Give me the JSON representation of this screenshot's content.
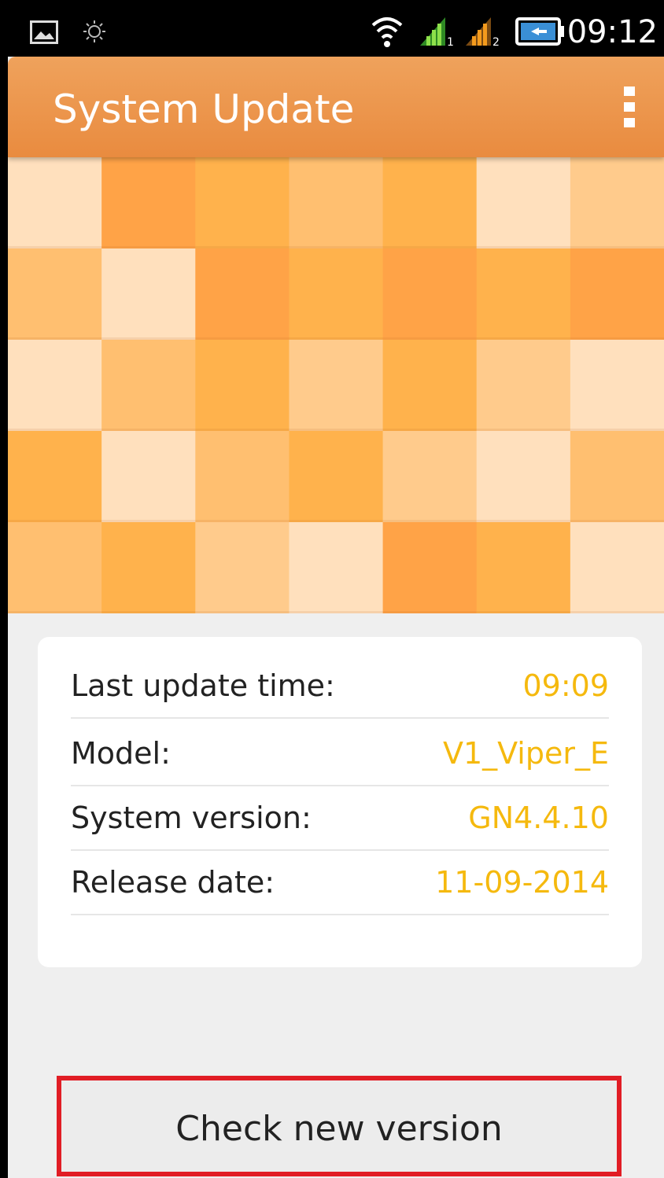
{
  "status_bar": {
    "time": "09:12",
    "icons": [
      "gallery-notification-icon",
      "brightness-icon",
      "wifi-icon",
      "signal-sim1-icon",
      "signal-sim2-icon",
      "battery-charging-icon"
    ]
  },
  "app_bar": {
    "title": "System Update",
    "menu_icon": "overflow-menu-icon"
  },
  "info": {
    "rows": [
      {
        "label": "Last update time:",
        "value": "09:09"
      },
      {
        "label": "Model:",
        "value": "V1_Viper_E"
      },
      {
        "label": "System version:",
        "value": "GN4.4.10"
      },
      {
        "label": "Release date:",
        "value": "11-09-2014"
      }
    ]
  },
  "actions": {
    "check_label": "Check new version"
  },
  "colors": {
    "app_bar": "#e98b3f",
    "value_text": "#f5b90e",
    "highlight_border": "#e11d25",
    "background": "#efefef"
  }
}
